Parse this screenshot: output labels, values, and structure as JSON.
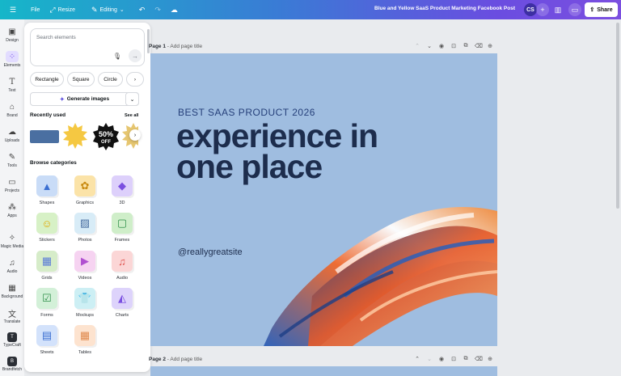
{
  "topbar": {
    "menu_icon": "hamburger-icon",
    "file": "File",
    "resize": "Resize",
    "editing": "Editing",
    "title": "Blue and Yellow SaaS Product Marketing Facebook Post",
    "avatar": "CS",
    "share": "Share"
  },
  "rail": {
    "items": [
      {
        "label": "Design",
        "icon": "design-icon"
      },
      {
        "label": "Elements",
        "icon": "elements-icon"
      },
      {
        "label": "Text",
        "icon": "text-icon"
      },
      {
        "label": "Brand",
        "icon": "brand-icon"
      },
      {
        "label": "Uploads",
        "icon": "uploads-icon"
      },
      {
        "label": "Tools",
        "icon": "tools-icon"
      },
      {
        "label": "Projects",
        "icon": "projects-icon"
      },
      {
        "label": "Apps",
        "icon": "apps-icon"
      },
      {
        "label": "Magic Media",
        "icon": "magic-media-icon"
      },
      {
        "label": "Audio",
        "icon": "audio-icon"
      },
      {
        "label": "Background",
        "icon": "background-icon"
      },
      {
        "label": "Translate",
        "icon": "translate-icon"
      },
      {
        "label": "TypeCraft",
        "icon": "typecraft-icon"
      },
      {
        "label": "Brandfetch",
        "icon": "brandfetch-icon"
      }
    ]
  },
  "panel": {
    "search_placeholder": "Search elements",
    "chips": [
      "Rectangle",
      "Square",
      "Circle"
    ],
    "generate": "Generate images",
    "recently_used": "Recently used",
    "see_all": "See all",
    "badge_text": "50%\nOFF",
    "browse": "Browse categories",
    "categories": [
      {
        "label": "Shapes",
        "color": "#c9dcf7"
      },
      {
        "label": "Graphics",
        "color": "#fbe3a8"
      },
      {
        "label": "3D",
        "color": "#ddd0fb"
      },
      {
        "label": "Stickers",
        "color": "#d7f1c6"
      },
      {
        "label": "Photos",
        "color": "#d8ecf7"
      },
      {
        "label": "Frames",
        "color": "#cfeec9"
      },
      {
        "label": "Grids",
        "color": "#d6ecc9"
      },
      {
        "label": "Videos",
        "color": "#f6d3f1"
      },
      {
        "label": "Audio",
        "color": "#fbd6d6"
      },
      {
        "label": "Forms",
        "color": "#d3f0d8"
      },
      {
        "label": "Mockups",
        "color": "#cdeff4"
      },
      {
        "label": "Charts",
        "color": "#ddd3fb"
      },
      {
        "label": "Sheets",
        "color": "#d3e2fb"
      },
      {
        "label": "Tables",
        "color": "#fde3cf"
      }
    ]
  },
  "page1": {
    "label": "Page 1",
    "title_placeholder": "Add page title"
  },
  "page2": {
    "label": "Page 2",
    "title_placeholder": "Add page title"
  },
  "design": {
    "kicker": "BEST SAAS PRODUCT 2026",
    "headline_line1": "experience in",
    "headline_line2": "one place",
    "handle": "@reallygreatsite",
    "background": "#9fbde0"
  }
}
